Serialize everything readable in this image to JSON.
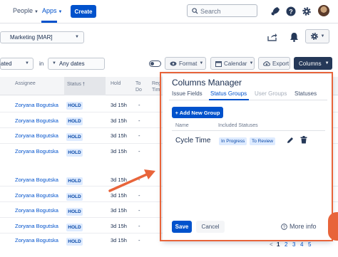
{
  "nav": {
    "people": "People",
    "apps": "Apps",
    "create": "Create",
    "search_placeholder": "Search",
    "icons": [
      "rocket-icon",
      "help-icon",
      "settings-icon",
      "avatar"
    ]
  },
  "toolbar": {
    "dataset": "Marketing [MAR]",
    "icons": [
      "share-icon",
      "bell-icon",
      "gear-icon"
    ]
  },
  "filters": {
    "created_partial": "ated",
    "in_label": "in",
    "date_range": "Any dates",
    "format": "Format",
    "calendar": "Calendar",
    "export": "Export",
    "columns": "Columns"
  },
  "table": {
    "headers": {
      "assignee": "Assignee",
      "status": "Status",
      "hold": "Hold",
      "to_do_1": "To",
      "to_do_2": "Do",
      "reg_1": "Reg",
      "reg_2": "Tim"
    },
    "rows": [
      {
        "assignee": "Zoryana Bogutska",
        "status": "HOLD",
        "hold": "3d 15h",
        "todo": "-"
      },
      {
        "assignee": "Zoryana Bogutska",
        "status": "HOLD",
        "hold": "3d 15h",
        "todo": "-"
      },
      {
        "assignee": "Zoryana Bogutska",
        "status": "HOLD",
        "hold": "3d 15h",
        "todo": "-"
      },
      {
        "assignee": "Zoryana Bogutska",
        "status": "HOLD",
        "hold": "3d 15h",
        "todo": "-"
      },
      {
        "assignee": "Zoryana Bogutska",
        "status": "HOLD",
        "hold": "3d 15h",
        "todo": "-"
      },
      {
        "assignee": "Zoryana Bogutska",
        "status": "HOLD",
        "hold": "3d 15h",
        "todo": "-"
      },
      {
        "assignee": "Zoryana Bogutska",
        "status": "HOLD",
        "hold": "3d 15h",
        "todo": "-"
      },
      {
        "assignee": "Zoryana Bogutska",
        "status": "HOLD",
        "hold": "3d 15h",
        "todo": "-"
      },
      {
        "assignee": "Zoryana Bogutska",
        "status": "HOLD",
        "hold": "3d 15h",
        "todo": "-"
      }
    ]
  },
  "pagination": {
    "prev": "<",
    "pages": [
      "1",
      "2",
      "3",
      "4",
      "5"
    ]
  },
  "dialog": {
    "title": "Columns Manager",
    "tabs": [
      "Issue Fields",
      "Status Groups",
      "User Groups",
      "Statuses"
    ],
    "active_tab": "Status Groups",
    "add_group": "+ Add New Group",
    "col_name": "Name",
    "col_statuses": "Included Statuses",
    "groups": [
      {
        "name": "Cycle Time",
        "statuses": [
          "In Progress",
          "To Review"
        ]
      }
    ],
    "save": "Save",
    "cancel": "Cancel",
    "more_info": "More info"
  },
  "colors": {
    "accent": "#0052cc",
    "highlight": "#e8643a",
    "columns_btn": "#253858",
    "badge_bg": "#deebff"
  }
}
